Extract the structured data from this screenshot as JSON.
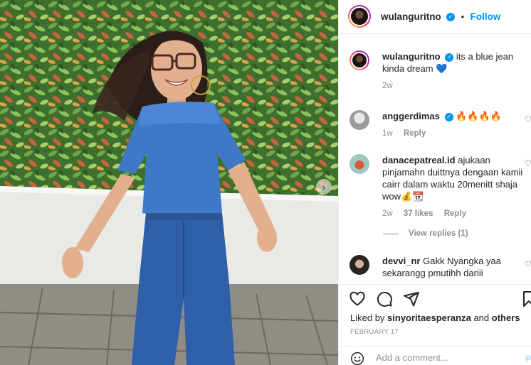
{
  "post": {
    "author": "wulanguritno",
    "follow_label": "Follow",
    "separator": "•",
    "caption": "its a blue jean kinda dream 💙",
    "caption_time": "2w"
  },
  "comments": [
    {
      "user": "anggerdimas",
      "verified": true,
      "text": "🔥🔥🔥🔥",
      "time": "1w",
      "likes": "",
      "reply_label": "Reply"
    },
    {
      "user": "danacepatreal.id",
      "verified": false,
      "text": "ajukaan pinjamahn duittnya dengaan kamii cairr dalam waktu 20menitt shaja wow💰📆",
      "time": "2w",
      "likes": "37 likes",
      "reply_label": "Reply"
    },
    {
      "user": "devvi_nr",
      "verified": false,
      "text": "Gakk Nyangka yaa sekarangg pmutihh dariii",
      "time": "",
      "likes": "",
      "reply_label": ""
    }
  ],
  "view_replies": "View replies (1)",
  "likes": {
    "prefix": "Liked by",
    "user": "sinyoritaesperanza",
    "middle": "and",
    "others": "others"
  },
  "date": "FEBRUARY 17",
  "add_comment": {
    "placeholder": "Add a comment...",
    "post_label": "P"
  },
  "icons": {
    "like": "heart-icon",
    "comment": "comment-bubble-icon",
    "share": "paper-plane-icon",
    "save": "bookmark-icon",
    "emoji": "smiley-icon",
    "verified": "verified-badge-icon",
    "next": "chevron-right-icon"
  },
  "colors": {
    "accent": "#0095f6",
    "muted": "#8e8e8e",
    "text": "#262626"
  }
}
